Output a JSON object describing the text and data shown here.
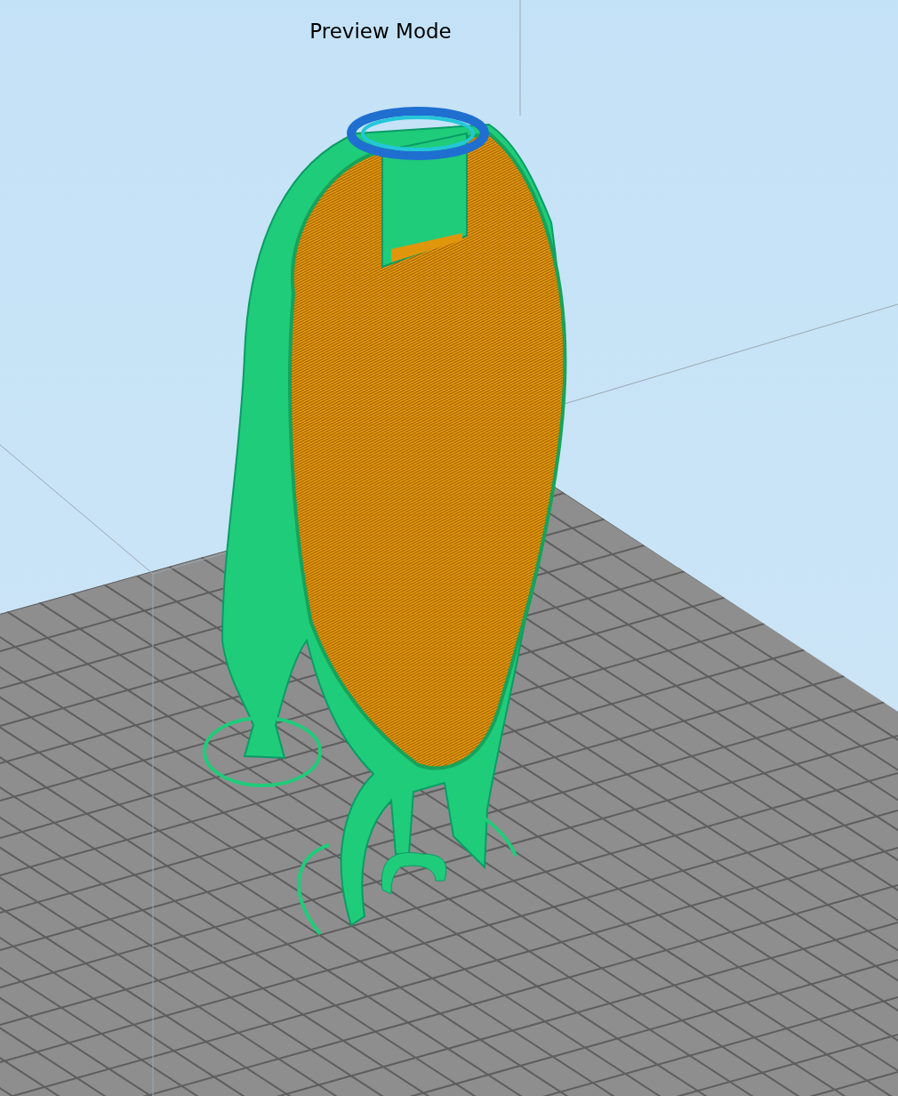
{
  "viewport": {
    "title": "Preview Mode"
  }
}
